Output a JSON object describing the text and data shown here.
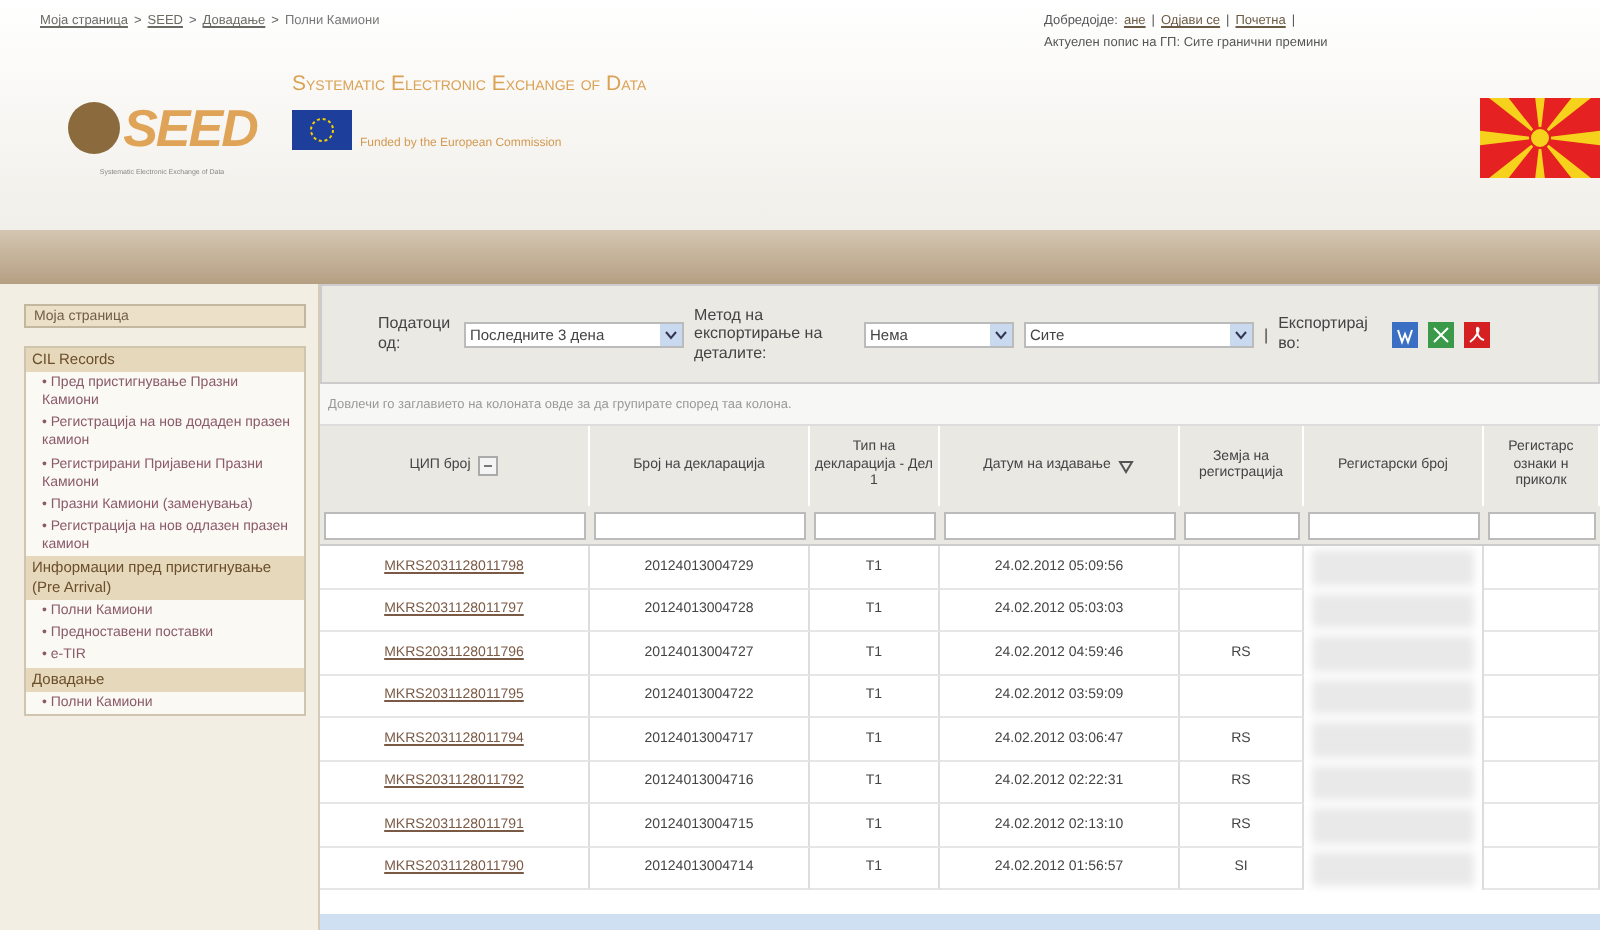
{
  "breadcrumb": [
    {
      "label": "Моја страница",
      "link": true
    },
    {
      "label": "SEED",
      "link": true
    },
    {
      "label": "Довадање",
      "link": true
    },
    {
      "label": "Полни Камиони",
      "link": false
    }
  ],
  "separator": ">",
  "user_bar": {
    "greeting": "Добредојде:",
    "user": "ане",
    "links": [
      "Одјави се",
      "Почетна"
    ],
    "info": "Актуелен попис на ГП: Сите гранични премини",
    "divider": "|"
  },
  "logo": {
    "text": "SEED",
    "tagline": "Systematic Electronic Exchange of Data"
  },
  "site_title": "Systematic Electronic Exchange of Data",
  "funded": "Funded by the European Commission",
  "sidebar": {
    "home": "Моја страница",
    "bullet": "•",
    "sections": [
      {
        "title": "CIL Records",
        "items": [
          "Пред пристигнување Празни Камиони",
          "Регистрација на нов додаден празен камион",
          "Регистрирани Пријавени Празни Камиони",
          "Празни Камиони (заменувања)",
          "Регистрација на нов одлазен празен камион"
        ]
      },
      {
        "title": "Информации пред пристигнување (Pre Arrival)",
        "items": [
          "Полни Камиони",
          "Предноставени поставки",
          "e-TIR"
        ]
      },
      {
        "title": "Довадање",
        "items": [
          "Полни Камиони"
        ]
      }
    ]
  },
  "toolbar": {
    "data_from": {
      "label": "Податоци од:",
      "value": "Последните 3 дена"
    },
    "export_method": {
      "label": "Метод на експортирање на деталите:",
      "value": "Нема"
    },
    "scope": {
      "value": "Сите"
    },
    "export_to": {
      "label": "Експортирај во:",
      "divider": "|"
    }
  },
  "group_hint": "Довлечи го заглавието на колоната овде за да групирате според таа колона.",
  "table": {
    "columns": [
      "ЦИП број",
      "Број на декларација",
      "Тип на декларација - Дел 1",
      "Датум на издавање",
      "Земја на регистрација",
      "Регистарски број",
      "Регистарс ознаки н приколк"
    ],
    "rows": [
      [
        "MKRS2031128011798",
        "20124013004729",
        "T1",
        "24.02.2012 05:09:56",
        ""
      ],
      [
        "MKRS2031128011797",
        "20124013004728",
        "T1",
        "24.02.2012 05:03:03",
        ""
      ],
      [
        "MKRS2031128011796",
        "20124013004727",
        "T1",
        "24.02.2012 04:59:46",
        "RS"
      ],
      [
        "MKRS2031128011795",
        "20124013004722",
        "T1",
        "24.02.2012 03:59:09",
        ""
      ],
      [
        "MKRS2031128011794",
        "20124013004717",
        "T1",
        "24.02.2012 03:06:47",
        "RS"
      ],
      [
        "MKRS2031128011792",
        "20124013004716",
        "T1",
        "24.02.2012 02:22:31",
        "RS"
      ],
      [
        "MKRS2031128011791",
        "20124013004715",
        "T1",
        "24.02.2012 02:13:10",
        "RS"
      ],
      [
        "MKRS2031128011790",
        "20124013004714",
        "T1",
        "24.02.2012 01:56:57",
        "SI"
      ]
    ]
  }
}
